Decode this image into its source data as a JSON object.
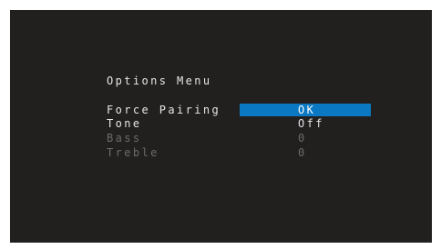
{
  "menu": {
    "title": "Options Menu",
    "items": [
      {
        "label": "Force Pairing",
        "value": "OK",
        "selected": true,
        "enabled": true
      },
      {
        "label": "Tone",
        "value": "Off",
        "selected": false,
        "enabled": true
      },
      {
        "label": "Bass",
        "value": "0",
        "selected": false,
        "enabled": false
      },
      {
        "label": "Treble",
        "value": "0",
        "selected": false,
        "enabled": false
      }
    ]
  },
  "colors": {
    "background": "#221f1f",
    "text": "#e6e6e6",
    "disabled_text": "#6e6b6b",
    "highlight": "#0a78c2"
  }
}
